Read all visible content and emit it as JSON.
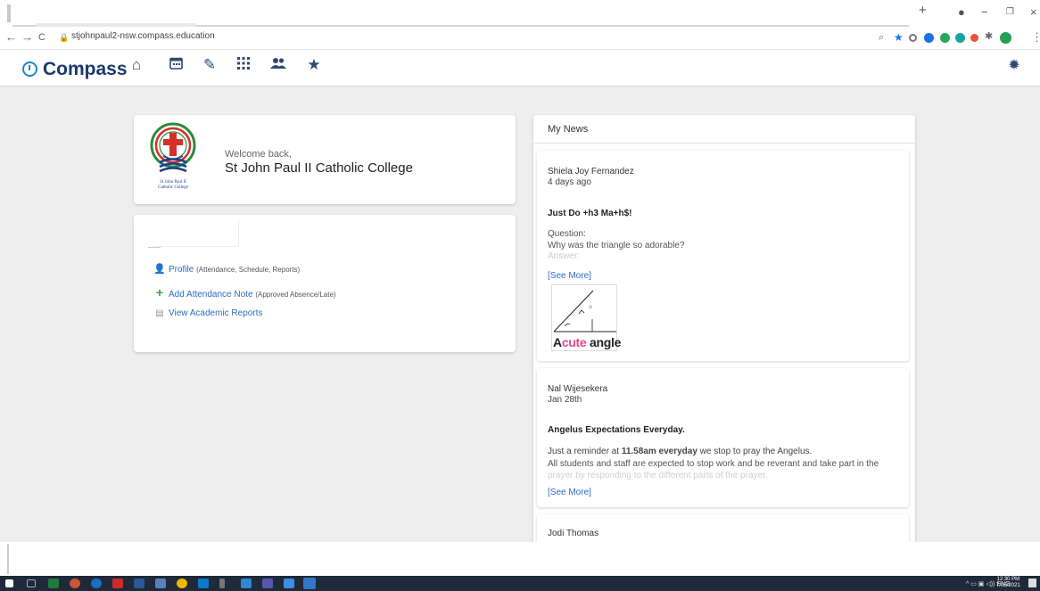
{
  "browser": {
    "url": "stjohnpaul2-nsw.compass.education",
    "new_tab_label": "+",
    "nav_back": "←",
    "nav_forward": "→",
    "nav_reload": "C"
  },
  "app": {
    "brand": "Compass",
    "nav_icons": [
      "home-icon",
      "calendar-icon",
      "pencil-icon",
      "grid-icon",
      "people-icon",
      "star-icon"
    ],
    "settings_icon": "gear-icon"
  },
  "welcome": {
    "greeting": "Welcome back,",
    "school_name": "St John Paul II Catholic College",
    "crest_caption_1": "St John Paul II",
    "crest_caption_2": "Catholic College"
  },
  "links": [
    {
      "label": "Profile",
      "note": "(Attendance, Schedule, Reports)",
      "icon": "person-icon"
    },
    {
      "label": "Add Attendance Note",
      "note": "(Approved Absence/Late)",
      "icon": "plus-icon"
    },
    {
      "label": "View Academic Reports",
      "note": "",
      "icon": "document-icon"
    }
  ],
  "news": {
    "title": "My News",
    "items": [
      {
        "author": "Shiela Joy Fernandez",
        "date": "4 days ago",
        "headline": "Just Do +h3 Ma+h$!",
        "body1": "Question:",
        "body2": "Why was the triangle so adorable?",
        "body3": "Answer:",
        "see_more": "[See More]",
        "image_caption_a": "A",
        "image_caption_b": "cute",
        "image_caption_c": " angle"
      },
      {
        "author": "Nal Wijesekera",
        "date": "Jan 28th",
        "headline": "Angelus Expectations Everyday.",
        "body1_pre": "Just a reminder at ",
        "body1_bold": "11.58am everyday",
        "body1_post": " we stop to pray the Angelus.",
        "body2": "All students and staff are expected to stop work and be reverant and take part in the",
        "body3": "prayer by responding to the different parts of the prayer.",
        "see_more": "[See More]"
      },
      {
        "author": "Jodi Thomas"
      }
    ]
  },
  "taskbar": {
    "tray_lang": "ENG",
    "time": "12:30 PM",
    "date": "7/05/2021"
  },
  "colors": {
    "brand_blue": "#1b87d0",
    "link_blue": "#2a6ebf",
    "nav_dark": "#2c4a73",
    "content_bg": "#eeeeee"
  }
}
